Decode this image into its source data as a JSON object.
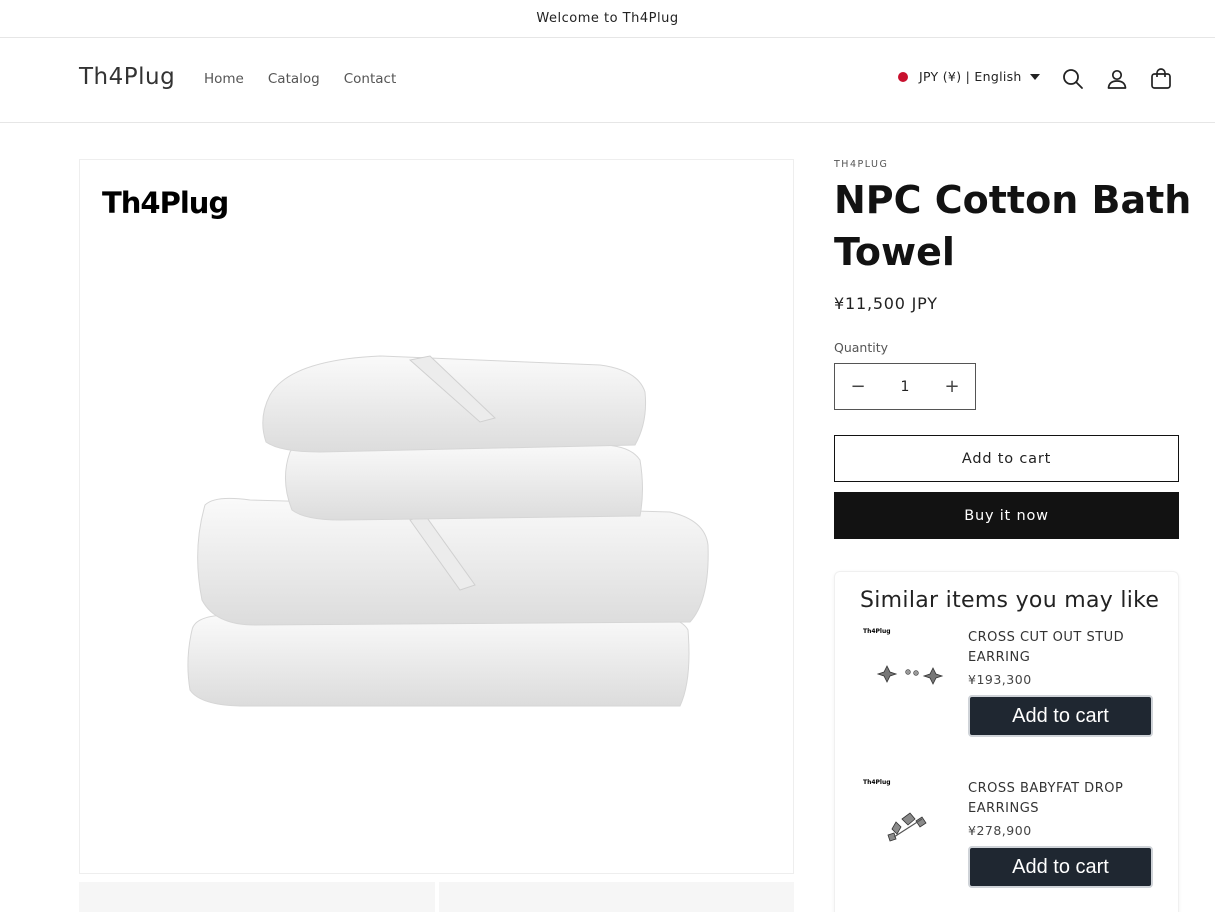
{
  "announcement": "Welcome to Th4Plug",
  "header": {
    "logo": "Th4Plug",
    "nav": [
      "Home",
      "Catalog",
      "Contact"
    ],
    "locale": "JPY (¥) | English",
    "icons": [
      "search-icon",
      "account-icon",
      "cart-icon"
    ]
  },
  "gallery": {
    "image_logo": "Th4Plug",
    "image_subject": "folded-white-towels"
  },
  "product": {
    "vendor": "TH4PLUG",
    "title": "NPC Cotton Bath Towel",
    "price": "¥11,500 JPY",
    "quantity_label": "Quantity",
    "quantity_value": "1",
    "add_to_cart": "Add to cart",
    "buy_now": "Buy it now"
  },
  "similar": {
    "heading": "Similar items you may like",
    "items": [
      {
        "logo": "Th4Plug",
        "name": "CROSS CUT OUT STUD EARRING",
        "price": "¥193,300",
        "button": "Add to cart"
      },
      {
        "logo": "Th4Plug",
        "name": "CROSS BABYFAT DROP EARRINGS",
        "price": "¥278,900",
        "button": "Add to cart"
      }
    ]
  },
  "colors": {
    "accent_dark": "#121212",
    "similar_button": "#1f2731",
    "flag_red": "#c8102e"
  }
}
